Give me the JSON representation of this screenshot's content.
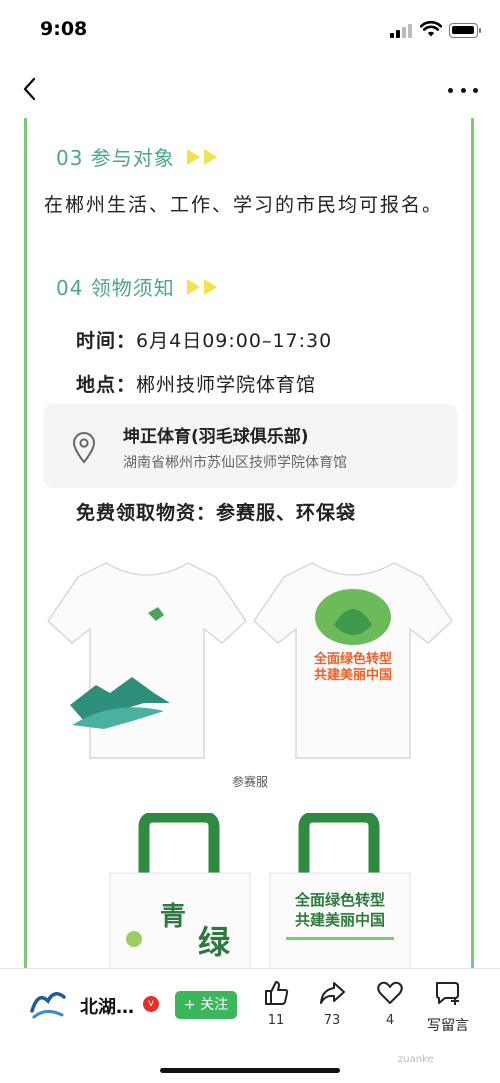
{
  "status_bar": {
    "time": "9:08"
  },
  "sections": [
    {
      "title": "03 参与对象",
      "body": "在郴州生活、工作、学习的市民均可报名。"
    },
    {
      "title": "04 领物须知"
    }
  ],
  "info": {
    "time_label": "时间：",
    "time_value": "6月4日09:00–17:30",
    "place_label": "地点：",
    "place_value": "郴州技师学院体育馆"
  },
  "location_card": {
    "name": "坤正体育(羽毛球俱乐部)",
    "address": "湖南省郴州市苏仙区技师学院体育馆",
    "icon": "map-pin-icon"
  },
  "free_items": "免费领取物资：参赛服、环保袋",
  "images": {
    "shirt_print_text": "全面绿色转型 共建美丽中国",
    "shirt_caption": "参赛服",
    "bag_left_text": "青 绿",
    "bag_right_text": "全面绿色转型 共建美丽中国"
  },
  "author": {
    "name": "北湖…",
    "verified": "v"
  },
  "follow_label": "+ 关注",
  "actions": {
    "like_count": "11",
    "share_count": "73",
    "favorite_count": "4",
    "comment_label": "写留言"
  },
  "watermark": "zuanke"
}
